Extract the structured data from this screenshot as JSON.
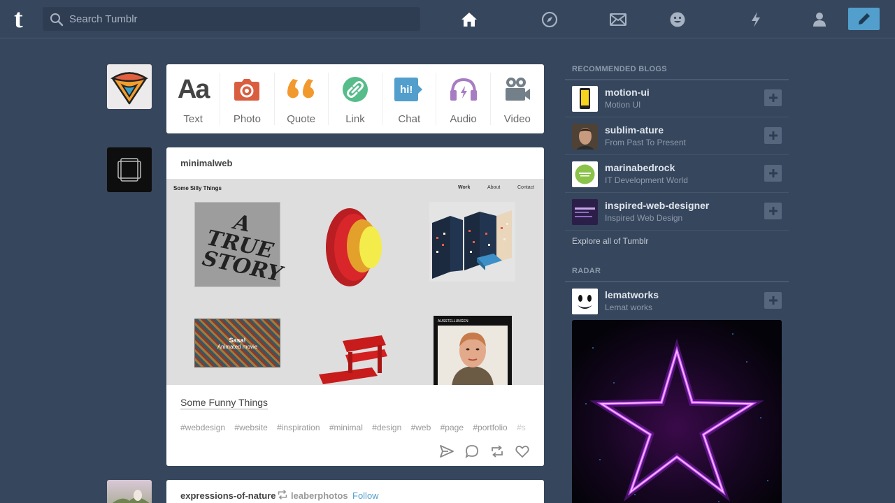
{
  "header": {
    "logo": "t",
    "search_placeholder": "Search Tumblr",
    "nav": [
      "home-icon",
      "explore-icon",
      "inbox-icon",
      "messaging-icon",
      "activity-icon",
      "account-icon"
    ],
    "compose": "pencil-icon"
  },
  "post_types": [
    {
      "label": "Text",
      "icon_text": "Aa",
      "color": "#444444"
    },
    {
      "label": "Photo",
      "color": "#d95e40"
    },
    {
      "label": "Quote",
      "color": "#f2992e"
    },
    {
      "label": "Link",
      "color": "#56bc8a"
    },
    {
      "label": "Chat",
      "icon_text": "hi!",
      "color": "#529ecc"
    },
    {
      "label": "Audio",
      "color": "#a77dc2"
    },
    {
      "label": "Video",
      "color": "#748089"
    }
  ],
  "post": {
    "author": "minimalweb",
    "image": {
      "site_title": "Some Silly Things",
      "nav": [
        "Work",
        "About",
        "Contact"
      ],
      "tile_caption": "Sasa!",
      "tile_sub": "Animated movie",
      "tile_header": "AUSSTELLUNGEN",
      "tile_truestory": "A TRUE STORY"
    },
    "caption": "Some Funny Things",
    "tags": [
      "#webdesign",
      "#website",
      "#inspiration",
      "#minimal",
      "#design",
      "#web",
      "#page",
      "#portfolio",
      "#s"
    ],
    "actions": [
      "share-icon",
      "reply-icon",
      "reblog-icon",
      "like-icon"
    ]
  },
  "post2": {
    "author": "expressions-of-nature",
    "reblogged_from": "leaberphotos",
    "follow": "Follow"
  },
  "sidebar": {
    "recommended_title": "RECOMMENDED BLOGS",
    "recommended": [
      {
        "name": "motion-ui",
        "sub": "Motion UI"
      },
      {
        "name": "sublim-ature",
        "sub": "From Past To Present"
      },
      {
        "name": "marinabedrock",
        "sub": "IT Development World"
      },
      {
        "name": "inspired-web-designer",
        "sub": "Inspired Web Design"
      }
    ],
    "explore": "Explore all of Tumblr",
    "radar_title": "RADAR",
    "radar": {
      "name": "lematworks",
      "sub": "Lemat works"
    }
  },
  "colors": {
    "background": "#36465d",
    "accent": "#529ecc"
  }
}
